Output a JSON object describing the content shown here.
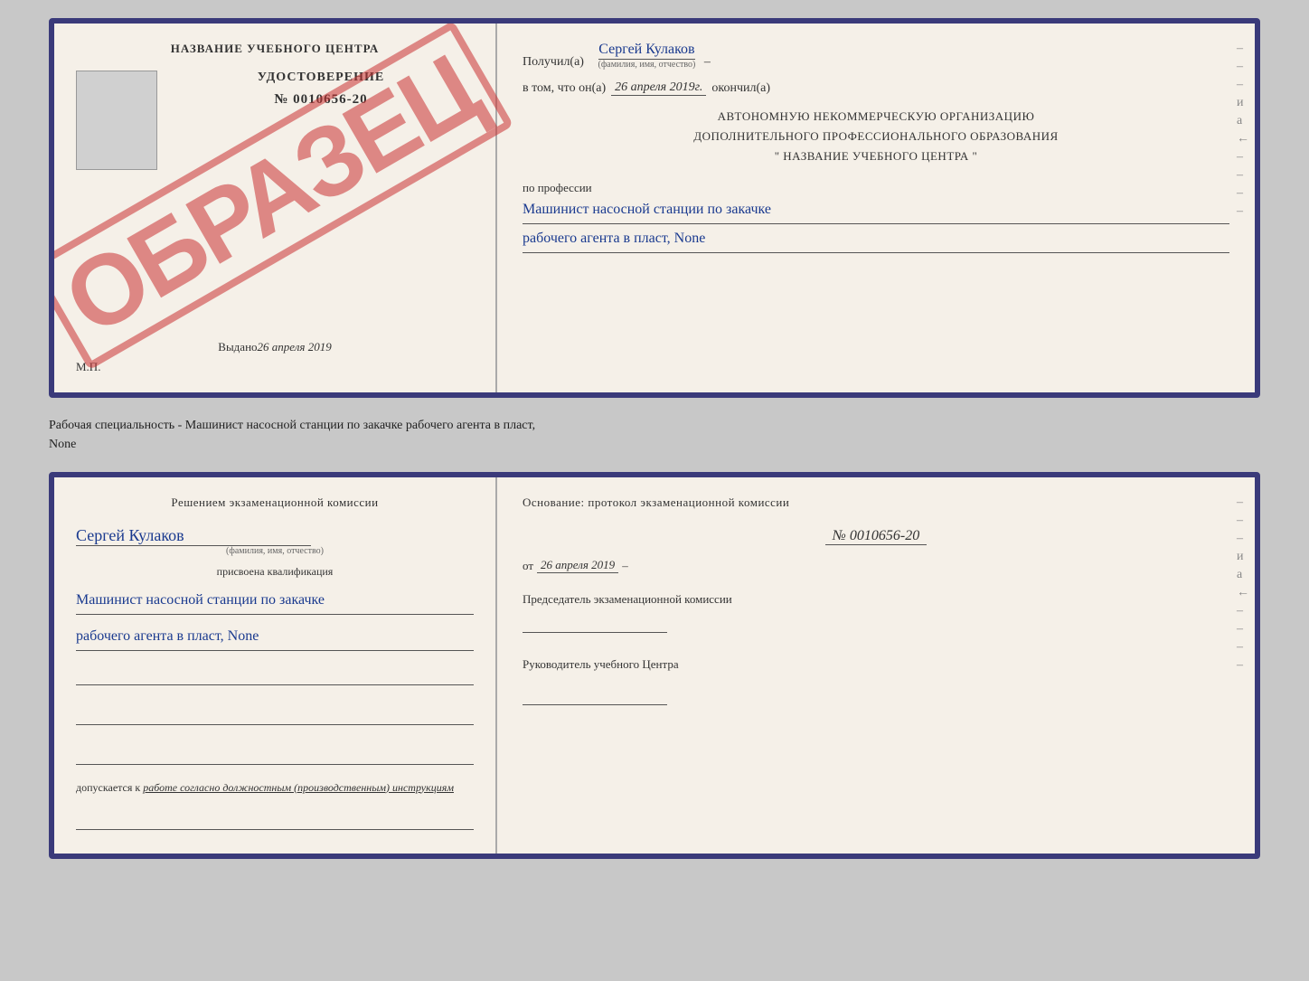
{
  "top_document": {
    "left": {
      "title": "НАЗВАНИЕ УЧЕБНОГО ЦЕНТРА",
      "stamp_text": "ОБРАЗЕЦ",
      "cert_label": "УДОСТОВЕРЕНИЕ",
      "cert_number": "№ 0010656-20",
      "issued_label": "Выдано",
      "issued_date": "26 апреля 2019",
      "mp_label": "М.П."
    },
    "right": {
      "received_label": "Получил(а)",
      "recipient_name": "Сергей Кулаков",
      "name_subtext": "(фамилия, имя, отчество)",
      "date_label": "в том, что он(а)",
      "date_value": "26 апреля 2019г.",
      "date_end_label": "окончил(а)",
      "org_line1": "АВТОНОМНУЮ НЕКОММЕРЧЕСКУЮ ОРГАНИЗАЦИЮ",
      "org_line2": "ДОПОЛНИТЕЛЬНОГО ПРОФЕССИОНАЛЬНОГО ОБРАЗОВАНИЯ",
      "org_line3": "\"  НАЗВАНИЕ УЧЕБНОГО ЦЕНТРА  \"",
      "profession_label": "по профессии",
      "profession_line1": "Машинист насосной станции по закачке",
      "profession_line2": "рабочего агента в пласт, None"
    }
  },
  "separator": {
    "text_line1": "Рабочая специальность - Машинист насосной станции по закачке рабочего агента в пласт,",
    "text_line2": "None"
  },
  "bottom_document": {
    "left": {
      "commission_title": "Решением экзаменационной комиссии",
      "name": "Сергей Кулаков",
      "name_subtext": "(фамилия, имя, отчество)",
      "qualification_label": "присвоена квалификация",
      "qualification_line1": "Машинист насосной станции по закачке",
      "qualification_line2": "рабочего агента в пласт, None",
      "allowed_label": "допускается к",
      "allowed_text": "работе согласно должностным (производственным) инструкциям"
    },
    "right": {
      "basis_label": "Основание: протокол экзаменационной комиссии",
      "protocol_number": "№ 0010656-20",
      "protocol_date_prefix": "от",
      "protocol_date": "26 апреля 2019",
      "chairman_label": "Председатель экзаменационной комиссии",
      "director_label": "Руководитель учебного Центра"
    }
  },
  "dashes": [
    "-",
    "-",
    "-",
    "и",
    "а",
    "←",
    "-",
    "-",
    "-",
    "-"
  ],
  "dashes_bottom": [
    "-",
    "-",
    "-",
    "и",
    "а",
    "←",
    "-",
    "-",
    "-",
    "-"
  ]
}
